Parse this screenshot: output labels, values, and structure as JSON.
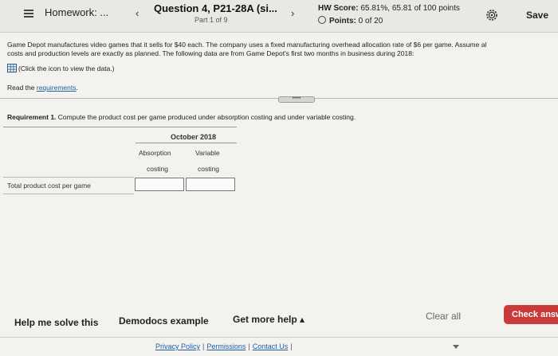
{
  "header": {
    "homework_label": "Homework: ...",
    "question_title": "Question 4, P21-28A (si...",
    "question_part": "Part 1 of 9",
    "hw_score_label": "HW Score:",
    "hw_score_value": "65.81%, 65.81 of 100 points",
    "points_label": "Points:",
    "points_value": "0 of 20",
    "save_label": "Save"
  },
  "problem": {
    "intro_line1": "Game Depot manufactures video games that it sells for $40 each. The company uses a fixed manufacturing overhead allocation rate of $6 per game. Assume al",
    "intro_line2": "costs and production levels are exactly as planned. The following data are from Game Depot's first two months in business during 2018:",
    "data_link_text": "(Click the icon to view the data.)",
    "read_label": "Read the",
    "requirements_link": "requirements",
    "requirements_suffix": "."
  },
  "requirement": {
    "label": "Requirement 1.",
    "text": "Compute the product cost per game produced under absorption costing and under variable costing."
  },
  "table": {
    "month_header": "October 2018",
    "col1_line1": "Absorption",
    "col1_line2": "costing",
    "col2_line1": "Variable",
    "col2_line2": "costing",
    "row_label": "Total product cost per game",
    "absorption_value": "",
    "variable_value": ""
  },
  "footer": {
    "help_label": "Help me solve this",
    "demo_label": "Demodocs example",
    "more_help_label": "Get more help",
    "more_help_caret": "▴",
    "clear_label": "Clear all",
    "check_label": "Check answer",
    "privacy": "Privacy Policy",
    "permissions": "Permissions",
    "contact": "Contact Us",
    "separator": "|"
  },
  "colors": {
    "accent_red": "#c93a3a",
    "link_blue": "#1d5fa6"
  },
  "icons": [
    "menu-icon",
    "prev-icon",
    "next-icon",
    "gear-icon",
    "table-icon"
  ]
}
